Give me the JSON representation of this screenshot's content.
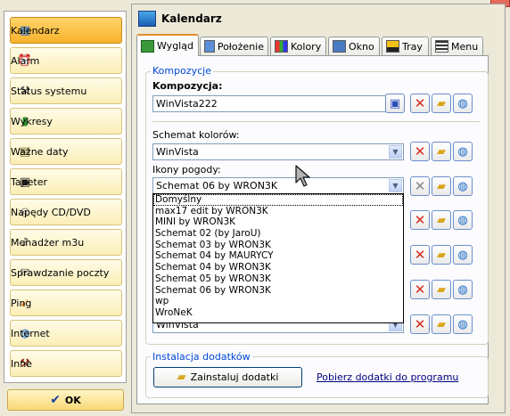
{
  "sidebar": {
    "items": [
      {
        "label": "Kalendarz",
        "icon": "calendar-icon",
        "glyph": "▦"
      },
      {
        "label": "Alarm",
        "icon": "alarm-clock-icon",
        "glyph": "⏰"
      },
      {
        "label": "Status systemu",
        "icon": "tools-icon",
        "glyph": "⚒"
      },
      {
        "label": "Wykresy",
        "icon": "bar-chart-icon",
        "glyph": "▮"
      },
      {
        "label": "Ważne daty",
        "icon": "calendar-note-icon",
        "glyph": "▤"
      },
      {
        "label": "Tapeter",
        "icon": "monitor-icon",
        "glyph": "▣"
      },
      {
        "label": "Napędy CD/DVD",
        "icon": "cd-icon",
        "glyph": "◎"
      },
      {
        "label": "Menadżer m3u",
        "icon": "music-icon",
        "glyph": "♪"
      },
      {
        "label": "Sprawdzanie poczty",
        "icon": "mail-icon",
        "glyph": "✉"
      },
      {
        "label": "Ping",
        "icon": "ping-icon",
        "glyph": "➹"
      },
      {
        "label": "Internet",
        "icon": "globe-icon",
        "glyph": "◍"
      },
      {
        "label": "Inne",
        "icon": "hammer-icon",
        "glyph": "⚒"
      }
    ],
    "active_index": 0
  },
  "ok_button": {
    "label": "OK",
    "icon": "checkmark-icon",
    "glyph": "✔"
  },
  "panel": {
    "title": "Kalendarz"
  },
  "tabs": [
    {
      "label": "Wygląd",
      "icon": "layout-icon"
    },
    {
      "label": "Położenie",
      "icon": "position-icon"
    },
    {
      "label": "Kolory",
      "icon": "palette-icon"
    },
    {
      "label": "Okno",
      "icon": "window-icon"
    },
    {
      "label": "Tray",
      "icon": "tray-icon"
    },
    {
      "label": "Menu",
      "icon": "menu-icon"
    }
  ],
  "composition_group": {
    "title": "Kompozycje",
    "composition_label": "Kompozycja:",
    "composition_value": "WinVista222",
    "color_scheme_label": "Schemat kolorów:",
    "color_scheme_value": "WinVista",
    "weather_icons_label": "Ikony pogody:",
    "weather_icons_value": "Schemat 06 by WRON3K",
    "hidden_combo_value": "WinVista"
  },
  "weather_dropdown": {
    "options": [
      "Domyślny",
      "max17 edit by WRON3K",
      "MINI by WRON3K",
      "Schemat 02 (by JaroU)",
      "Schemat 03 by WRON3K",
      "Schemat 04 by MAURYCY",
      "Schemat 04 by WRON3K",
      "Schemat 05 by WRON3K",
      "Schemat 06 by WRON3K",
      "wp",
      "WroNeK"
    ],
    "focused_index": 0
  },
  "addons_group": {
    "title": "Instalacja dodatków",
    "install_button": "Zainstaluj dodatki",
    "download_link": "Pobierz dodatki do programu"
  }
}
